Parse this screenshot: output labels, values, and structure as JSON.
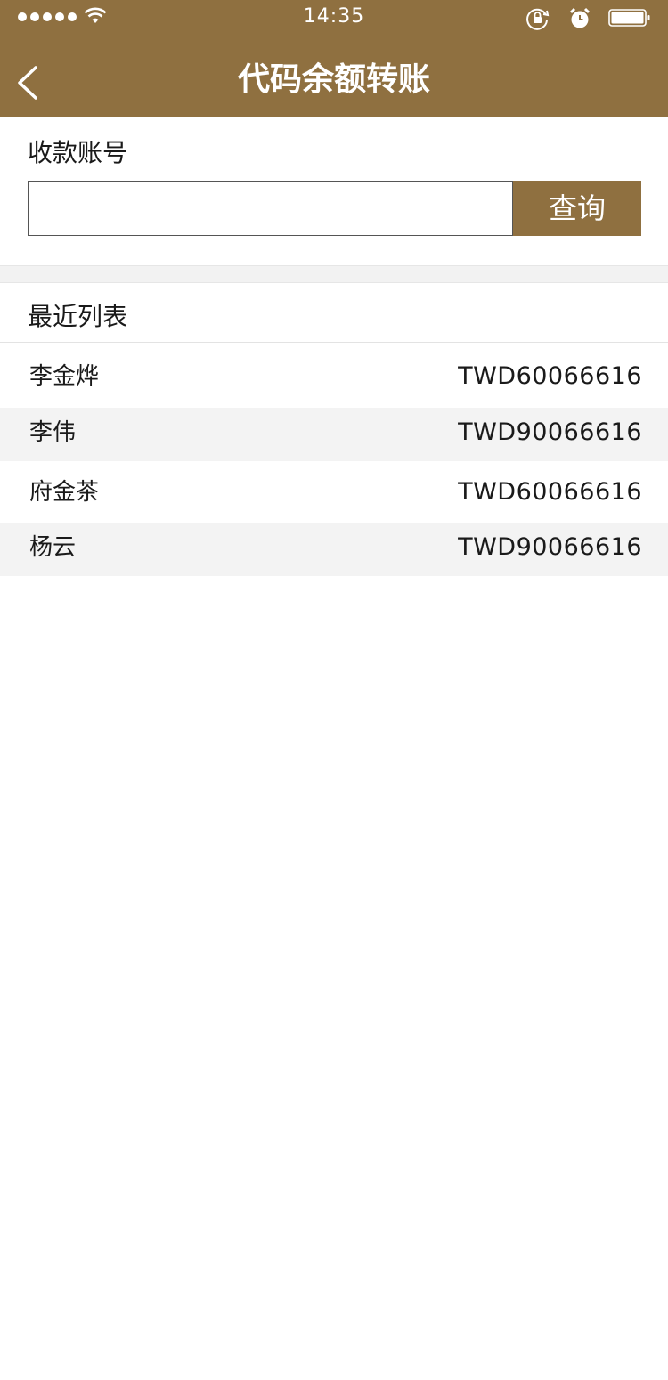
{
  "status_bar": {
    "time": "14:35"
  },
  "nav": {
    "title": "代码余额转账"
  },
  "recipient": {
    "label": "收款账号",
    "input_value": "",
    "query_label": "查询"
  },
  "recent": {
    "heading": "最近列表",
    "items": [
      {
        "name": "李金烨",
        "code": "TWD60066616"
      },
      {
        "name": "李伟",
        "code": "TWD90066616"
      },
      {
        "name": "府金茶",
        "code": "TWD60066616"
      },
      {
        "name": "杨云",
        "code": "TWD90066616"
      }
    ]
  },
  "colors": {
    "brand": "#8f7040",
    "row_alt": "#f3f3f3"
  }
}
